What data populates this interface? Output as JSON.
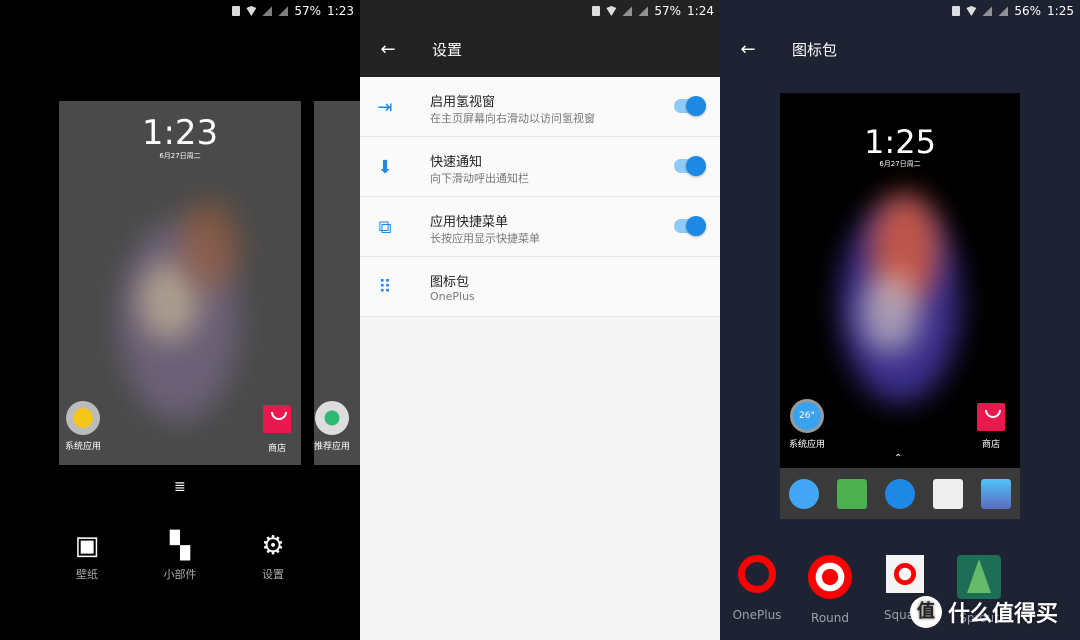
{
  "panels": [
    {
      "status": {
        "battery": "57%",
        "time": "1:23"
      },
      "lockscreen": {
        "time": "1:23",
        "date": "6月27日周二"
      },
      "apps": [
        {
          "label": "系统应用"
        },
        {
          "label": "商店"
        },
        {
          "label": "推荐应用"
        }
      ],
      "bottom_buttons": [
        {
          "label": "壁纸",
          "icon": "wallpaper-icon"
        },
        {
          "label": "小部件",
          "icon": "widgets-icon"
        },
        {
          "label": "设置",
          "icon": "gear-icon"
        }
      ]
    },
    {
      "status": {
        "battery": "57%",
        "time": "1:24"
      },
      "title": "设置",
      "settings": [
        {
          "title": "启用氢视窗",
          "subtitle": "在主页屏幕向右滑动以访问氢视窗",
          "toggle": true,
          "icon": "shelf-icon"
        },
        {
          "title": "快速通知",
          "subtitle": "向下滑动呼出通知栏",
          "toggle": true,
          "icon": "arrow-down-icon"
        },
        {
          "title": "应用快捷菜单",
          "subtitle": "长按应用显示快捷菜单",
          "toggle": true,
          "icon": "open-external-icon"
        },
        {
          "title": "图标包",
          "subtitle": "OnePlus",
          "icon": "grid-icon"
        }
      ]
    },
    {
      "status": {
        "battery": "56%",
        "time": "1:25"
      },
      "title": "图标包",
      "preview": {
        "time": "1:25",
        "date": "6月27日周二",
        "apps": [
          {
            "label": "系统应用",
            "badge": "26°"
          },
          {
            "label": "商店"
          }
        ]
      },
      "packs": [
        {
          "label": "OnePlus"
        },
        {
          "label": "Round"
        },
        {
          "label": "Square"
        },
        {
          "label": "Sprout"
        }
      ]
    }
  ],
  "watermark": {
    "logo": "值",
    "text": "什么值得买"
  },
  "colors": {
    "accent": "#1e88e5",
    "oneplus_red": "#ff0000",
    "dark_bg": "#1e2333"
  }
}
